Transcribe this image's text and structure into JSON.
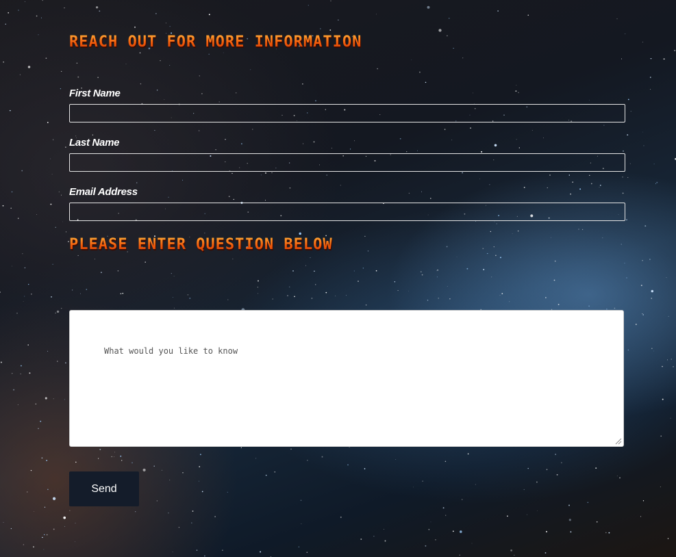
{
  "form": {
    "title": "Reach Out For More Information",
    "fields": [
      {
        "label": "First Name",
        "value": ""
      },
      {
        "label": "Last Name",
        "value": ""
      },
      {
        "label": "Email Address",
        "value": ""
      }
    ],
    "question_heading": "Please Enter Question Below",
    "question_placeholder": "What would you like to know",
    "submit_label": "Send"
  },
  "colors": {
    "heading": "#f25a0a",
    "label": "#ffffff",
    "field_border": "#e6e6e6",
    "button_bg": "#141c2a",
    "button_text": "#ffffff",
    "textarea_bg": "#ffffff"
  },
  "background": "starry-night-sky"
}
